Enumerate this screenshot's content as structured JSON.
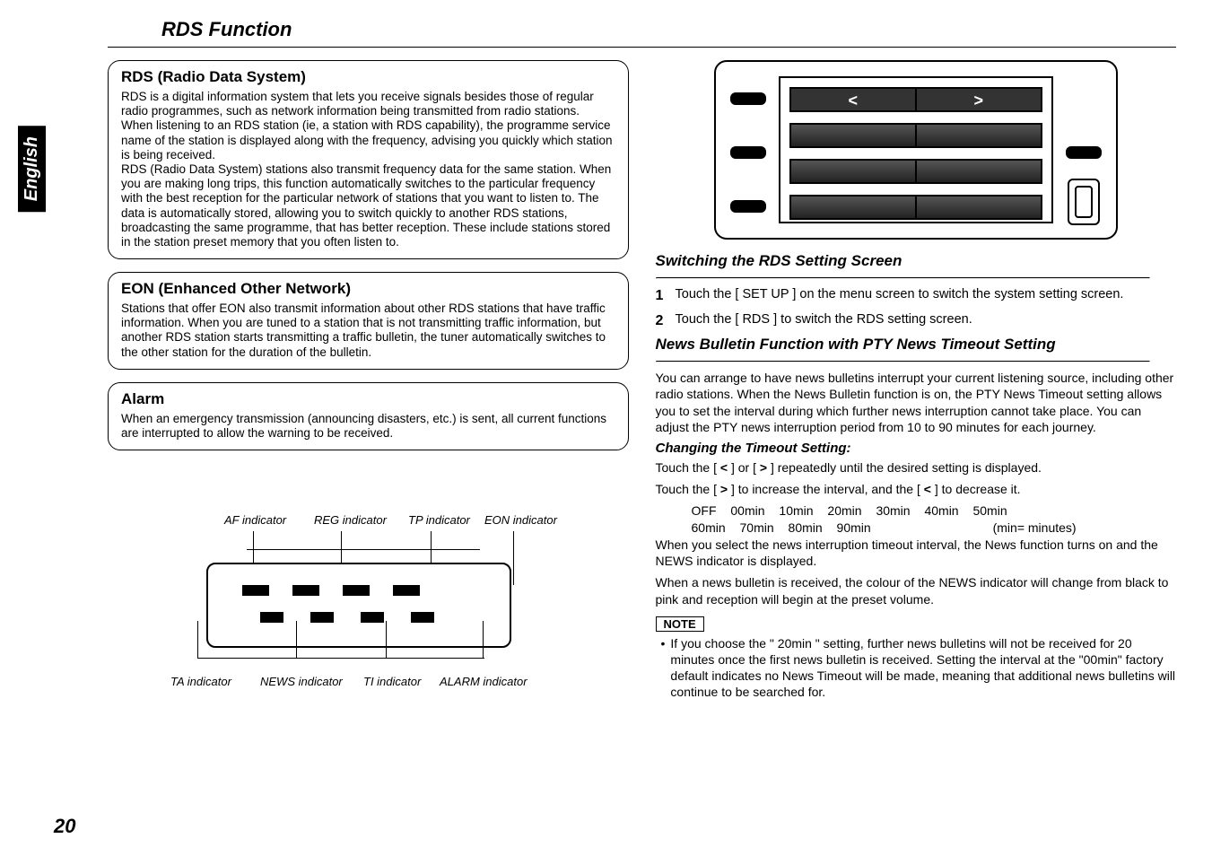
{
  "language_tab": "English",
  "page_title": "RDS Function",
  "page_number": "20",
  "left": {
    "rds": {
      "heading": "RDS (Radio Data System)",
      "body": "RDS is a digital information system that lets you receive signals besides those of regular radio programmes, such as network information being transmitted from radio stations.\nWhen listening to an RDS station (ie, a station with RDS capability), the programme service name of the station is displayed along with the frequency, advising you quickly which station is being received.\nRDS (Radio Data System) stations also transmit frequency data for the same station.  When you are making long trips, this function automatically switches to the particular frequency with the best reception for the particular network of stations that you want to listen to.  The data is automatically stored, allowing you to switch quickly to another RDS stations, broadcasting the same programme, that has better reception. These include stations stored in the station preset memory that you often listen to."
    },
    "eon": {
      "heading": "EON (Enhanced Other Network)",
      "body": "Stations that offer EON also transmit information about other RDS stations that have traffic information. When you are tuned to a station that is not transmitting traffic information, but another RDS station starts transmitting a traffic bulletin, the tuner automatically switches to the other station for the duration of the bulletin."
    },
    "alarm": {
      "heading": "Alarm",
      "body": "When an emergency transmission (announcing disasters, etc.) is sent, all current functions are interrupted to allow the warning to be received."
    },
    "diagram": {
      "top_labels": [
        "AF indicator",
        "REG indicator",
        "TP indicator",
        "EON indicator"
      ],
      "bottom_labels": [
        "TA indicator",
        "NEWS indicator",
        "TI indicator",
        "ALARM indicator"
      ]
    }
  },
  "right": {
    "switching_heading": "Switching the RDS Setting Screen",
    "step1_num": "1",
    "step1": "Touch the [ SET UP ] on the menu screen to switch the system setting screen.",
    "step2_num": "2",
    "step2": "Touch the [ RDS ] to switch the RDS setting screen.",
    "news_heading": "News Bulletin Function with PTY News Timeout Setting",
    "news_body": "You can arrange to have news bulletins interrupt your current listening source, including other radio stations. When the News Bulletin function is on, the PTY News Timeout setting allows you to set the interval during which further news interruption cannot take place.  You can adjust the PTY news interruption period from 10 to 90 minutes for each journey.",
    "changing_heading": "Changing the Timeout Setting:",
    "changing_line1a": "Touch the  [ ",
    "changing_line1b": " ] or  [ ",
    "changing_line1c": " ] repeatedly until the desired setting is displayed.",
    "changing_line2a": "Touch the  [ ",
    "changing_line2b": " ] to increase the interval, and the  [ ",
    "changing_line2c": " ] to decrease it.",
    "timeout_row1": "OFF    00min    10min    20min    30min    40min    50min",
    "timeout_row2": "60min    70min    80min    90min",
    "timeout_suffix": "(min= minutes)",
    "post1": "When you select the news interruption timeout interval, the News function turns on and the NEWS indicator is displayed.",
    "post2": "When a news bulletin is received, the colour of the NEWS indicator will change from black to pink and reception will begin at the preset volume.",
    "note_label": "NOTE",
    "note_bullet": "If you choose the \" 20min \" setting, further news bulletins will not be received for 20 minutes once the first news bulletin is received. Setting the interval at the \"00min\" factory default indicates no News Timeout will be made, meaning that additional news bulletins will continue to be searched for.",
    "arrow_left": "<",
    "arrow_right": ">"
  }
}
